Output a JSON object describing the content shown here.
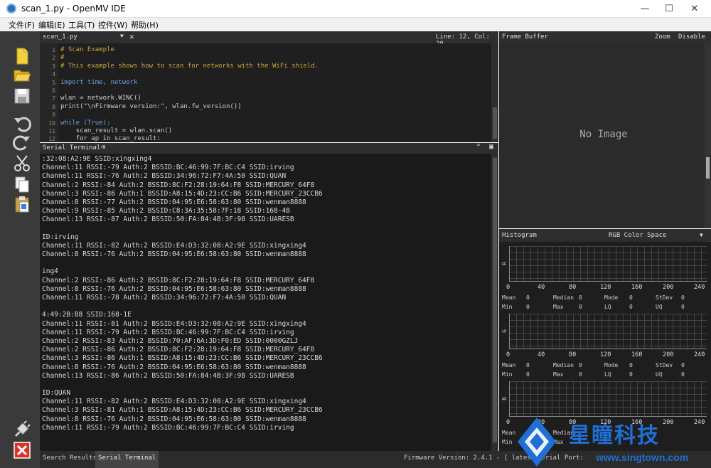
{
  "window": {
    "title": "scan_1.py - OpenMV IDE",
    "controls": [
      "—",
      "☐",
      "✕"
    ]
  },
  "menu": [
    "文件(F)",
    "编辑(E)",
    "工具(T)",
    "控件(W)",
    "帮助(H)"
  ],
  "toolbar": {
    "icons": [
      "new-file-icon",
      "open-file-icon",
      "save-icon",
      "undo-icon",
      "redo-icon",
      "cut-icon",
      "copy-icon",
      "paste-icon",
      "connect-icon",
      "stop-icon"
    ]
  },
  "editor": {
    "tab": "scan_1.py",
    "cursor": "Line: 12, Col: 20",
    "lines": [
      {
        "n": "1",
        "text": "# Scan Example",
        "cls": "c"
      },
      {
        "n": "2",
        "text": "#",
        "cls": "c"
      },
      {
        "n": "3",
        "text": "# This example shows how to scan for networks with the WiFi shield.",
        "cls": "c"
      },
      {
        "n": "4",
        "text": "",
        "cls": ""
      },
      {
        "n": "5",
        "text": "import time, network",
        "cls": "k"
      },
      {
        "n": "6",
        "text": "",
        "cls": ""
      },
      {
        "n": "7",
        "text": "wlan = network.WINC()",
        "cls": ""
      },
      {
        "n": "8",
        "text": "print(\"\\nFirmware version:\", wlan.fw_version())",
        "cls": ""
      },
      {
        "n": "9",
        "text": "",
        "cls": ""
      },
      {
        "n": "10",
        "text": "while (True):",
        "cls": "k"
      },
      {
        "n": "11",
        "text": "    scan_result = wlan.scan()",
        "cls": ""
      },
      {
        "n": "12",
        "text": "    for ap in scan_result:",
        "cls": ""
      }
    ]
  },
  "serial": {
    "tab": "Serial Terminal",
    "lines": [
      ":32:08:A2:9E SSID:xingxing4",
      "Channel:11 RSSI:-79 Auth:2 BSSID:BC:46:99:7F:BC:C4 SSID:irving",
      "Channel:11 RSSI:-76 Auth:2 BSSID:34:96:72:F7:4A:50 SSID:QUAN",
      "Channel:2 RSSI:-84 Auth:2 BSSID:8C:F2:28:19:64:F8 SSID:MERCURY_64F8",
      "Channel:3 RSSI:-86 Auth:1 BSSID:A8:15:4D:23:CC:B6 SSID:MERCURY_23CCB6",
      "Channel:8 RSSI:-77 Auth:2 BSSID:04:95:E6:58:63:80 SSID:wenman8888",
      "Channel:9 RSSI:-85 Auth:2 BSSID:C8:3A:35:58:7F:18 SSID:168-4B",
      "Channel:13 RSSI:-87 Auth:2 BSSID:50:FA:84:4B:3F:98 SSID:UARESB",
      "",
      "ID:irving",
      "Channel:11 RSSI:-82 Auth:2 BSSID:E4:D3:32:08:A2:9E SSID:xingxing4",
      "Channel:8 RSSI:-76 Auth:2 BSSID:04:95:E6:58:63:80 SSID:wenman8888",
      "",
      "ing4",
      "Channel:2 RSSI:-86 Auth:2 BSSID:8C:F2:28:19:64:F8 SSID:MERCURY_64F8",
      "Channel:8 RSSI:-76 Auth:2 BSSID:04:95:E6:58:63:80 SSID:wenman8888",
      "Channel:11 RSSI:-78 Auth:2 BSSID:34:96:72:F7:4A:50 SSID:QUAN",
      "",
      "4:49:2B:B8 SSID:168-1E",
      "Channel:11 RSSI:-81 Auth:2 BSSID:E4:D3:32:08:A2:9E SSID:xingxing4",
      "Channel:11 RSSI:-79 Auth:2 BSSID:BC:46:99:7F:BC:C4 SSID:irving",
      "Channel:2 RSSI:-83 Auth:2 BSSID:70:AF:6A:3D:F0:ED SSID:0000GZLJ",
      "Channel:2 RSSI:-86 Auth:2 BSSID:8C:F2:28:19:64:F8 SSID:MERCURY_64F8",
      "Channel:3 RSSI:-86 Auth:1 BSSID:A8:15:4D:23:CC:B6 SSID:MERCURY_23CCB6",
      "Channel:8 RSSI:-76 Auth:2 BSSID:04:95:E6:58:63:80 SSID:wenman8888",
      "Channel:13 RSSI:-86 Auth:2 BSSID:50:FA:84:4B:3F:98 SSID:UARESB",
      "",
      "ID:QUAN",
      "Channel:11 RSSI:-82 Auth:2 BSSID:E4:D3:32:08:A2:9E SSID:xingxing4",
      "Channel:3 RSSI:-81 Auth:1 BSSID:A8:15:4D:23:CC:B6 SSID:MERCURY_23CCB6",
      "Channel:8 RSSI:-76 Auth:2 BSSID:04:95:E6:58:63:80 SSID:wenman8888",
      "Channel:11 RSSI:-79 Auth:2 BSSID:BC:46:99:7F:BC:C4 SSID:irving"
    ]
  },
  "frame_buffer": {
    "title": "Frame Buffer",
    "zoom": "Zoom",
    "disable": "Disable",
    "placeholder": "No Image"
  },
  "histogram": {
    "title": "Histogram",
    "color_space": "RGB Color Space",
    "ticks": [
      "0",
      "40",
      "80",
      "120",
      "160",
      "200",
      "240"
    ],
    "channels": [
      {
        "label": "R",
        "row1": [
          "Mean",
          "0",
          "Median",
          "0",
          "Mode",
          "0",
          "StDev",
          "0"
        ],
        "row2": [
          "Min",
          "0",
          "Max",
          "0",
          "LQ",
          "0",
          "UQ",
          "0"
        ]
      },
      {
        "label": "G",
        "row1": [
          "Mean",
          "0",
          "Median",
          "0",
          "Mode",
          "0",
          "StDev",
          "0"
        ],
        "row2": [
          "Min",
          "0",
          "Max",
          "0",
          "LQ",
          "0",
          "UQ",
          "0"
        ]
      },
      {
        "label": "B",
        "row1": [
          "Mean",
          "",
          "Median",
          "",
          "",
          "",
          "",
          ""
        ],
        "row2": [
          "Min",
          "0",
          "Max",
          "",
          "",
          "",
          "",
          ""
        ]
      }
    ]
  },
  "bottom": {
    "search_results": "Search Results",
    "serial_terminal": "Serial Terminal",
    "firmware": "Firmware Version: 2.4.1 - [ latest ]",
    "serial_port": "Serial Port:"
  },
  "watermark": {
    "brand": "星瞳科技",
    "url": "www.singtown.com"
  },
  "colors": {
    "comment": "#c8a63a",
    "keyword": "#6aa0e0",
    "accent": "#1f6fd6"
  }
}
